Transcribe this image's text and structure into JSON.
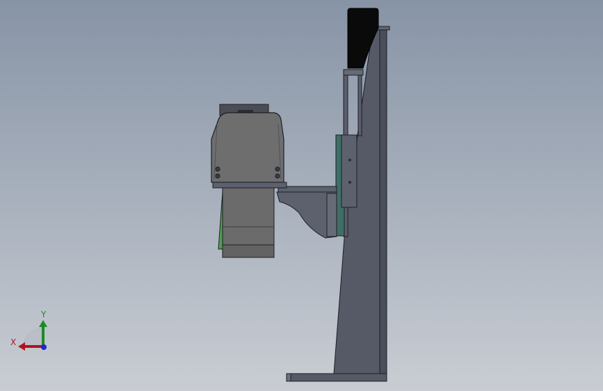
{
  "viewport": {
    "background_top": "#8794a6",
    "background_bottom": "#c9cdd3"
  },
  "triad": {
    "x_label": "X",
    "y_label": "Y",
    "x_color": "#b0141e",
    "y_color": "#1e8a28",
    "z_color": "#1a2ad6"
  },
  "model": {
    "frame_color": "#555a66",
    "motor_color": "#6e6e6e",
    "cap_color": "#0a0a0a",
    "plate_color": "#3e6f66",
    "accent_green": "#4fa04f"
  }
}
